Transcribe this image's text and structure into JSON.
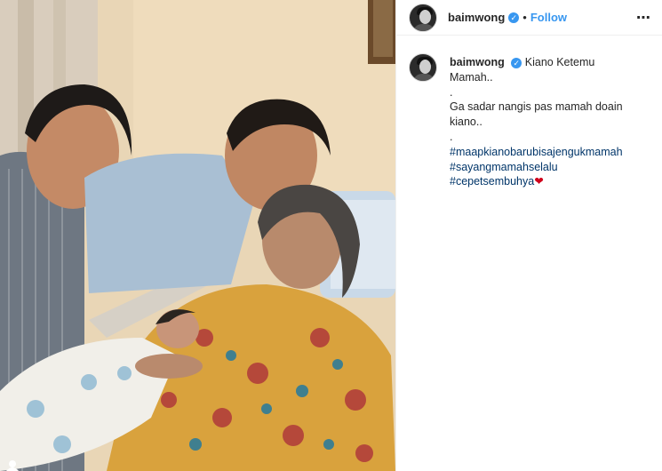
{
  "post": {
    "username": "baimwong",
    "follow_label": "Follow",
    "more_icon": "⋯",
    "verified_icon": "✓",
    "dot": "•"
  },
  "caption": {
    "username": "baimwong",
    "title": "Kiano Ketemu Mamah..",
    "line1": ".",
    "line2": "Ga sadar nangis pas mamah doain kiano..",
    "line3": ".",
    "hashtags": [
      "#maapkianobarubisajengukmamah",
      "#sayangmamahselalu",
      "#cepetsembuhya"
    ],
    "heart": "❤"
  },
  "colors": {
    "accent": "#3897f0",
    "hashtag": "#003569",
    "heart": "#d0021b"
  }
}
